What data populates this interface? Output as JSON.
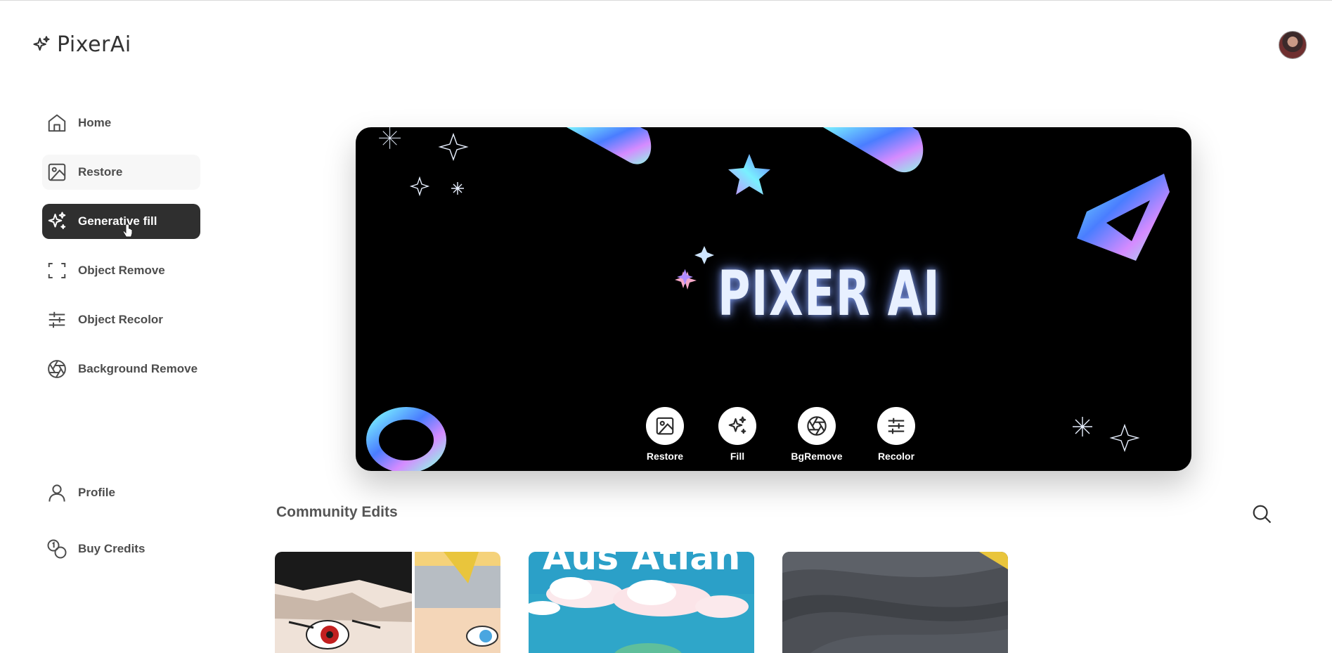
{
  "app": {
    "name": "PixerAi"
  },
  "sidebar": {
    "items": [
      {
        "label": "Home",
        "icon": "home-icon"
      },
      {
        "label": "Restore",
        "icon": "image-icon"
      },
      {
        "label": "Generative fill",
        "icon": "sparkles-icon"
      },
      {
        "label": "Object Remove",
        "icon": "scan-frame-icon"
      },
      {
        "label": "Object Recolor",
        "icon": "sliders-icon"
      },
      {
        "label": "Background Remove",
        "icon": "aperture-icon"
      }
    ],
    "active_index": 2,
    "bottom_items": [
      {
        "label": "Profile",
        "icon": "user-icon"
      },
      {
        "label": "Buy Credits",
        "icon": "coins-icon"
      }
    ]
  },
  "hero": {
    "title": "PIXER AI",
    "actions": [
      {
        "label": "Restore",
        "icon": "image-icon"
      },
      {
        "label": "Fill",
        "icon": "sparkles-icon"
      },
      {
        "label": "BgRemove",
        "icon": "aperture-icon"
      },
      {
        "label": "Recolor",
        "icon": "sliders-icon"
      }
    ]
  },
  "community": {
    "title": "Community Edits",
    "cards": [
      {
        "description": "anime-collage"
      },
      {
        "text": "Aus Atlan"
      },
      {
        "description": "grey-fabric"
      }
    ]
  },
  "colors": {
    "active_bg": "#2f2f2f",
    "hero_bg": "#000000",
    "hero_glow": "#a8b8ff"
  }
}
